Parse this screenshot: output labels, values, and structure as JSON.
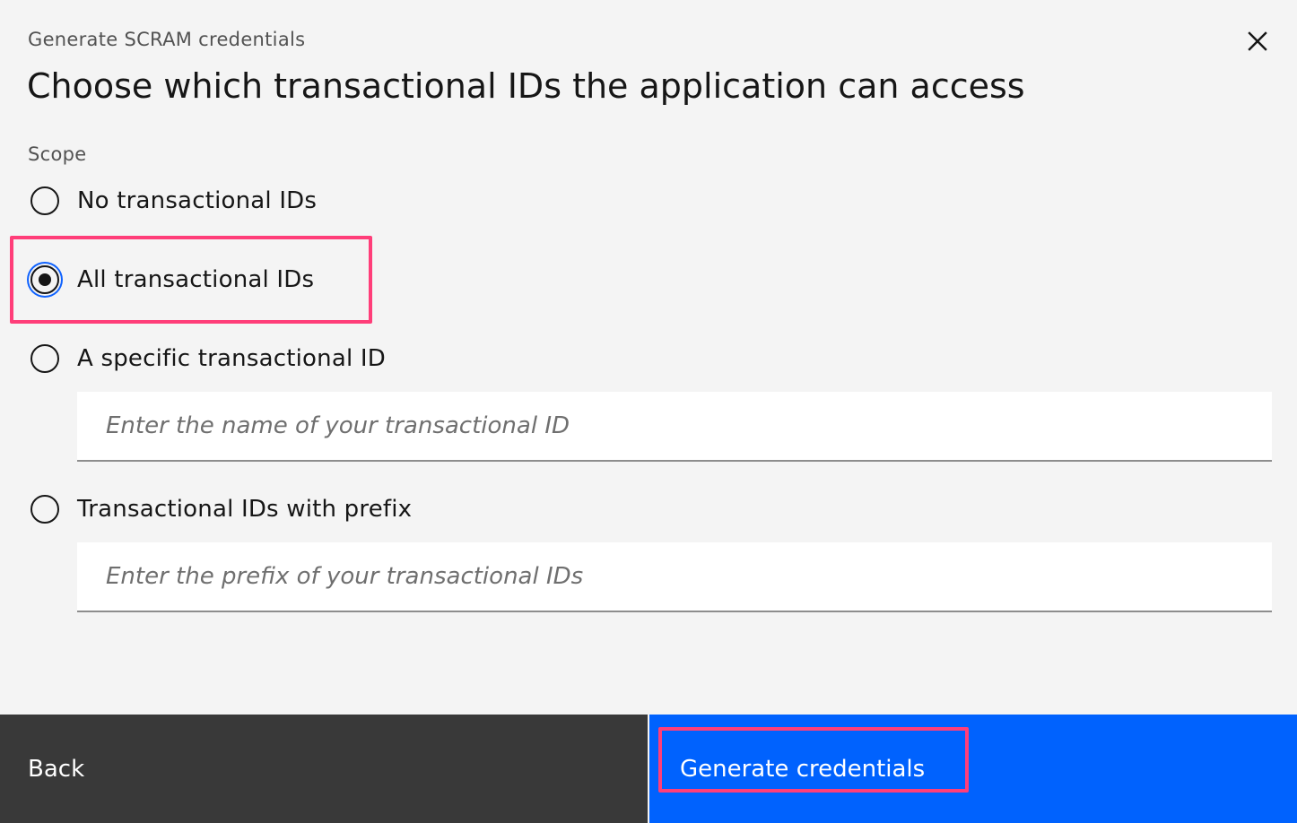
{
  "header": {
    "eyebrow": "Generate SCRAM credentials",
    "title": "Choose which transactional IDs the application can access",
    "close_icon": "close-icon"
  },
  "scope": {
    "label": "Scope",
    "options": [
      {
        "label": "No transactional IDs",
        "checked": false
      },
      {
        "label": "All transactional IDs",
        "checked": true
      },
      {
        "label": "A specific transactional ID",
        "checked": false
      },
      {
        "label": "Transactional IDs with prefix",
        "checked": false
      }
    ],
    "specific_input": {
      "placeholder": "Enter the name of your transactional ID",
      "value": ""
    },
    "prefix_input": {
      "placeholder": "Enter the prefix of your transactional IDs",
      "value": ""
    }
  },
  "footer": {
    "back_label": "Back",
    "primary_label": "Generate credentials"
  },
  "colors": {
    "background": "#f4f4f4",
    "primary": "#0062fe",
    "secondary": "#393939",
    "focus": "#0f62fe",
    "highlight": "#ff3e79"
  }
}
